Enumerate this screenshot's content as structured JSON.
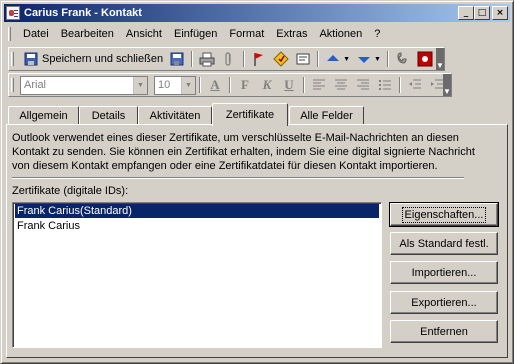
{
  "window": {
    "title": "Carius Frank - Kontakt",
    "minimize_glyph": "_",
    "maximize_glyph": "□",
    "close_glyph": "×"
  },
  "menubar": {
    "items": [
      {
        "label": "Datei"
      },
      {
        "label": "Bearbeiten"
      },
      {
        "label": "Ansicht"
      },
      {
        "label": "Einfügen"
      },
      {
        "label": "Format"
      },
      {
        "label": "Extras"
      },
      {
        "label": "Aktionen"
      },
      {
        "label": "?"
      }
    ]
  },
  "toolbar": {
    "save_close_label": "Speichern und schließen",
    "font_value": "Arial",
    "size_value": "10",
    "bold_label": "F",
    "italic_label": "K",
    "underline_label": "U",
    "font_color_label": "A"
  },
  "tabs": [
    {
      "label": "Allgemein"
    },
    {
      "label": "Details"
    },
    {
      "label": "Aktivitäten"
    },
    {
      "label": "Zertifikate",
      "active": true
    },
    {
      "label": "Alle Felder"
    }
  ],
  "certificates": {
    "description": "Outlook verwendet eines dieser Zertifikate, um verschlüsselte E-Mail-Nachrichten an diesen Kontakt zu senden. Sie können ein Zertifikat erhalten, indem Sie eine digital signierte Nachricht von diesem Kontakt empfangen oder eine Zertifikatdatei für diesen Kontakt importieren.",
    "list_label": "Zertifikate (digitale IDs):",
    "items": [
      {
        "label": "Frank Carius(Standard)",
        "selected": true
      },
      {
        "label": "Frank Carius",
        "selected": false
      }
    ],
    "buttons": {
      "properties": "Eigenschaften...",
      "set_default": "Als Standard festl.",
      "import": "Importieren...",
      "export": "Exportieren...",
      "remove": "Entfernen"
    }
  },
  "colors": {
    "title_start": "#0a246a",
    "title_end": "#a6caf0",
    "selection": "#0a246a",
    "face": "#d4d0c8"
  }
}
